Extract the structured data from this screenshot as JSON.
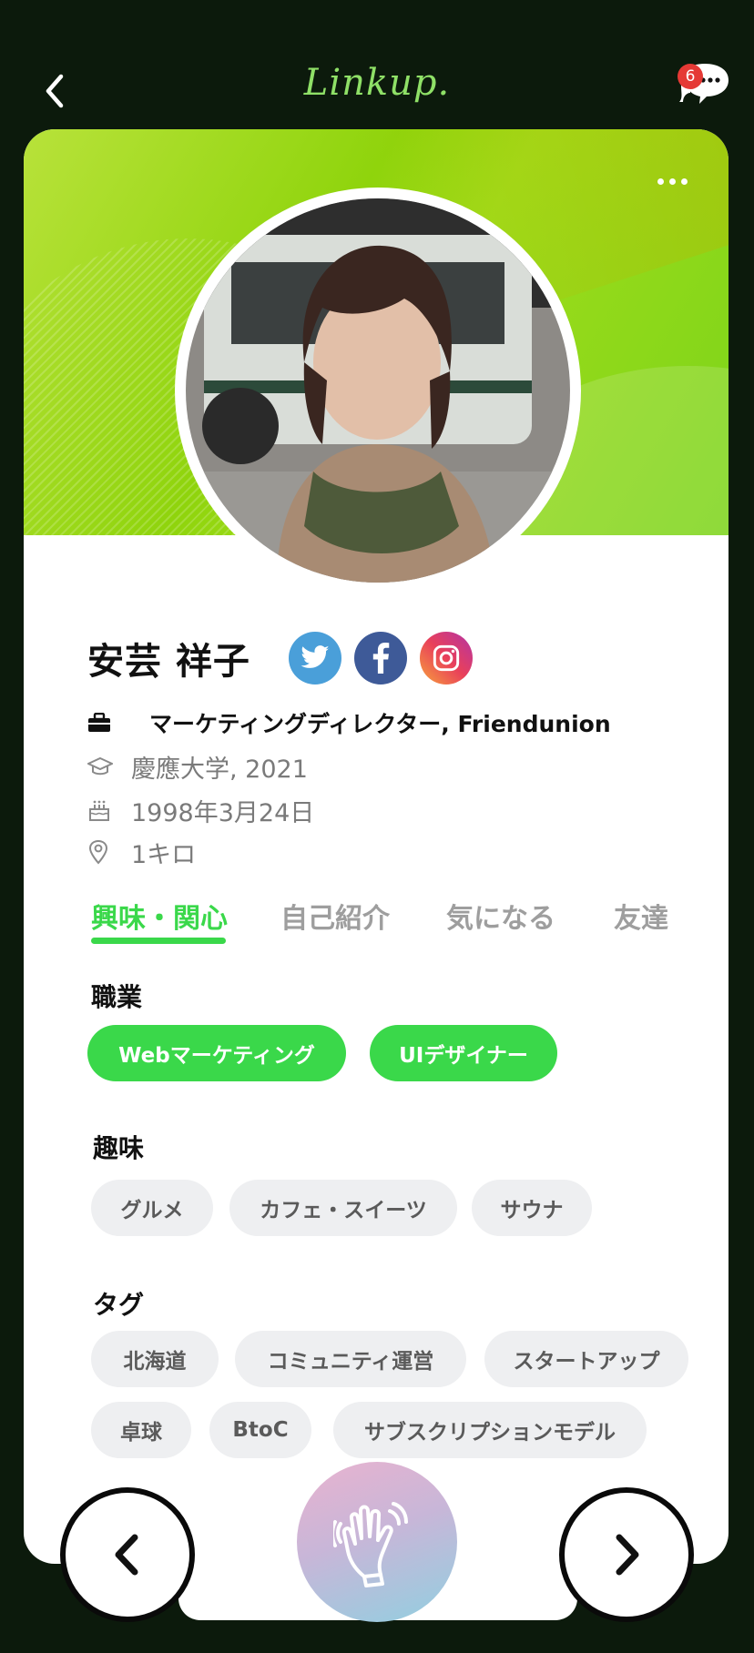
{
  "app": {
    "logo": "Linkup.",
    "chat_badge": "6"
  },
  "profile": {
    "name": "安芸 祥子",
    "job": "マーケティングディレクター, Friendunion",
    "education": "慶應大学, 2021",
    "birthday": "1998年3月24日",
    "distance": "1キロ"
  },
  "tabs": [
    {
      "label": "興味・関心",
      "active": true
    },
    {
      "label": "自己紹介",
      "active": false
    },
    {
      "label": "気になる",
      "active": false
    },
    {
      "label": "友達",
      "active": false
    }
  ],
  "sections": {
    "occupation": {
      "title": "職業",
      "chips": [
        "Webマーケティング",
        "UIデザイナー"
      ]
    },
    "hobbies": {
      "title": "趣味",
      "chips": [
        "グルメ",
        "カフェ・スイーツ",
        "サウナ"
      ]
    },
    "tags": {
      "title": "タグ",
      "chips": [
        "北海道",
        "コミュニティ運営",
        "スタートアップ",
        "卓球",
        "BtoC",
        "サブスクリプションモデル"
      ]
    }
  },
  "colors": {
    "background": "#0c1a0c",
    "accent": "#3ad84a",
    "logo": "#8fe067",
    "twitter": "#4a9fd9",
    "facebook": "#3e5a98"
  },
  "icons": [
    "back-arrow-icon",
    "chat-bubbles-icon",
    "more-dots-icon",
    "twitter-icon",
    "facebook-icon",
    "instagram-icon",
    "briefcase-icon",
    "graduation-cap-icon",
    "birthday-cake-icon",
    "location-pin-icon",
    "chevron-left-icon",
    "chevron-right-icon",
    "waving-hand-icon"
  ]
}
